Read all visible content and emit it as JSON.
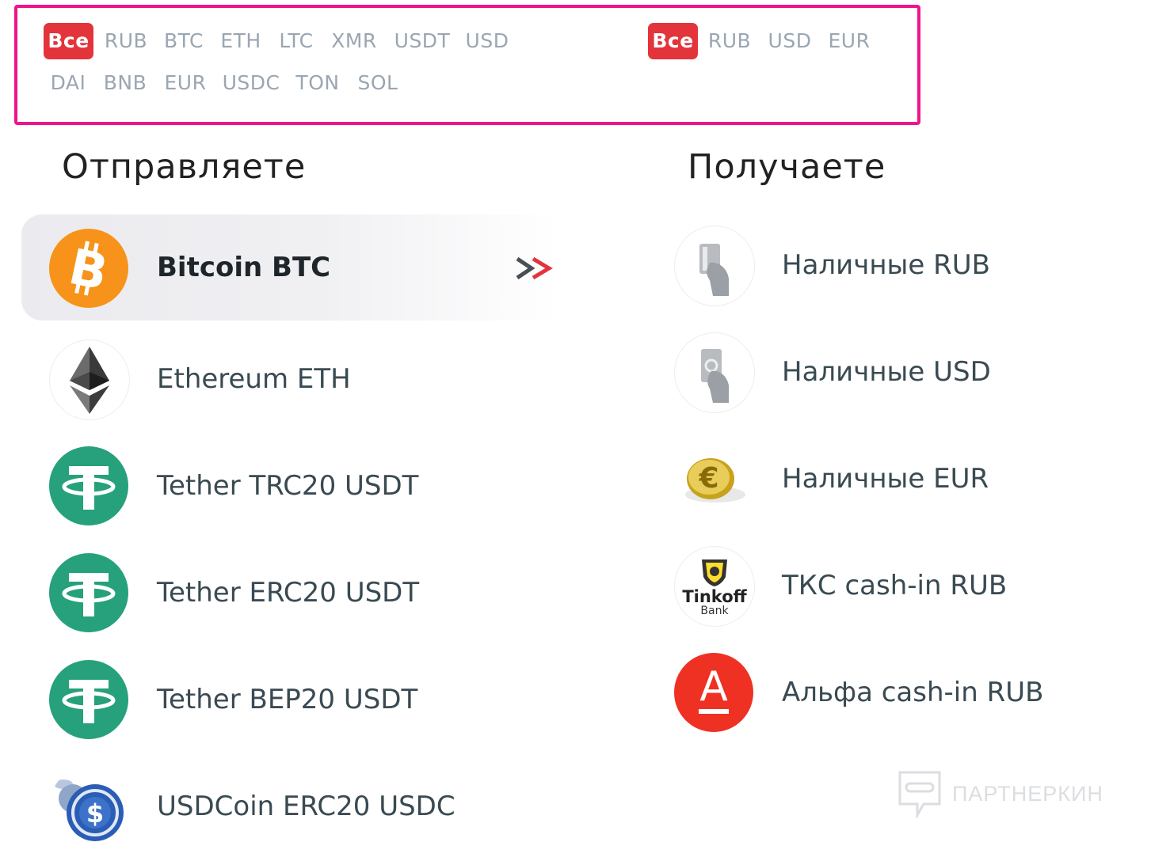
{
  "send_filters": {
    "row1": [
      "Все",
      "RUB",
      "BTC",
      "ETH",
      "LTC",
      "XMR",
      "USDT",
      "USD"
    ],
    "row2": [
      "DAI",
      "BNB",
      "EUR",
      "USDC",
      "TON",
      "SOL"
    ],
    "active": "Все"
  },
  "receive_filters": {
    "items": [
      "Все",
      "RUB",
      "USD",
      "EUR"
    ],
    "active": "Все"
  },
  "send": {
    "heading": "Отправляете",
    "items": [
      {
        "label": "Bitcoin BTC",
        "icon": "bitcoin-icon",
        "selected": true
      },
      {
        "label": "Ethereum ETH",
        "icon": "ethereum-icon"
      },
      {
        "label": "Tether TRC20 USDT",
        "icon": "tether-icon"
      },
      {
        "label": "Tether ERC20 USDT",
        "icon": "tether-icon"
      },
      {
        "label": "Tether BEP20 USDT",
        "icon": "tether-icon"
      },
      {
        "label": "USDCoin ERC20 USDC",
        "icon": "usdc-icon"
      }
    ]
  },
  "receive": {
    "heading": "Получаете",
    "items": [
      {
        "label": "Наличные RUB",
        "icon": "cash-card-hand-icon"
      },
      {
        "label": "Наличные USD",
        "icon": "cash-banknote-hand-icon"
      },
      {
        "label": "Наличные EUR",
        "icon": "euro-coin-icon"
      },
      {
        "label": "ТКС cash-in RUB",
        "icon": "tinkoff-logo"
      },
      {
        "label": "Альфа cash-in RUB",
        "icon": "alfa-bank-logo"
      }
    ]
  },
  "tinkoff_logo": {
    "name": "Tinkoff",
    "sub": "Bank"
  },
  "alfa_logo": {
    "letter": "А"
  },
  "watermark": {
    "text": "ПАРТНЕРКИН"
  },
  "colors": {
    "accent": "#e3343c",
    "highlight_frame": "#f0148b",
    "bitcoin": "#f7931a",
    "tether": "#26a17b",
    "alfa": "#ef3124"
  }
}
